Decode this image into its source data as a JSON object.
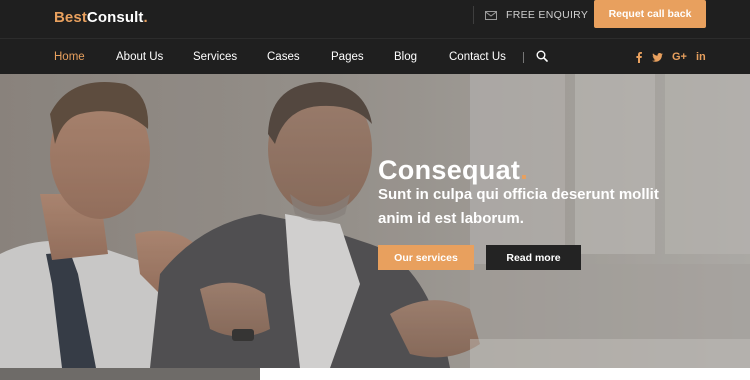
{
  "brand": {
    "logo_part1": "Best",
    "logo_part2": "Consult",
    "logo_dot": "."
  },
  "topbar": {
    "enquiry_label": "FREE ENQUIRY",
    "enquiry_icon": "envelope-icon",
    "callback_label": "Requet call back"
  },
  "nav": {
    "items": [
      {
        "label": "Home",
        "active": true
      },
      {
        "label": "About Us",
        "active": false
      },
      {
        "label": "Services",
        "active": false
      },
      {
        "label": "Cases",
        "active": false
      },
      {
        "label": "Pages",
        "active": false
      },
      {
        "label": "Blog",
        "active": false
      },
      {
        "label": "Contact Us",
        "active": false
      }
    ],
    "search_icon": "search-icon",
    "social": [
      {
        "icon": "facebook-icon",
        "glyph": "f"
      },
      {
        "icon": "twitter-icon",
        "glyph": "twitter"
      },
      {
        "icon": "google-plus-icon",
        "glyph": "G+"
      },
      {
        "icon": "linkedin-icon",
        "glyph": "in"
      }
    ]
  },
  "hero": {
    "title": "Consequat",
    "title_dot": ".",
    "subtitle_line1": "Sunt in culpa qui officia deserunt mollit",
    "subtitle_line2": "anim id est laborum.",
    "primary_button": "Our services",
    "secondary_button": "Read more"
  },
  "colors": {
    "accent": "#e8a05e",
    "header_bg": "#1f1f1f",
    "dark_button": "#232323"
  }
}
